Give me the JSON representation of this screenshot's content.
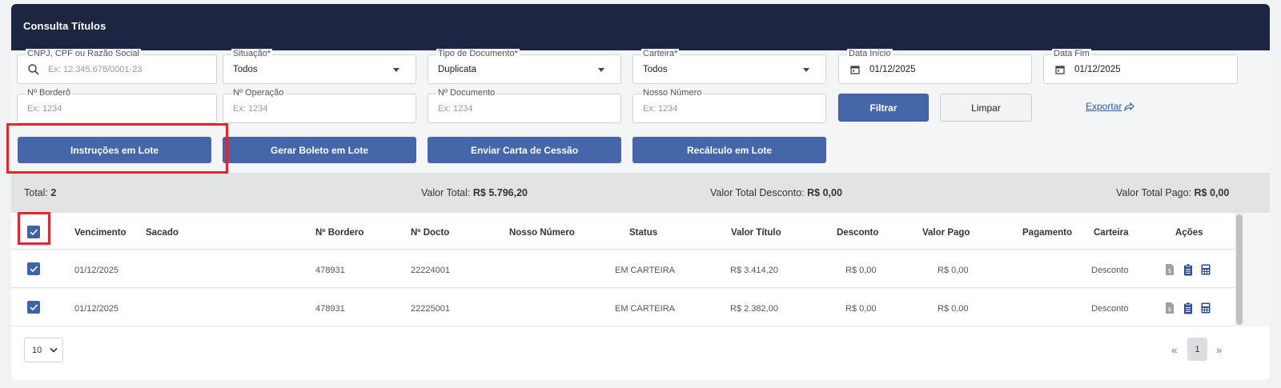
{
  "header": {
    "title": "Consulta Títulos"
  },
  "filters": {
    "cnpj": {
      "label": "CNPJ, CPF ou Razão Social",
      "placeholder": "Ex: 12.345.678/0001-23"
    },
    "situacao": {
      "label": "Situação*",
      "value": "Todos"
    },
    "tipo_documento": {
      "label": "Tipo de Documento*",
      "value": "Duplicata"
    },
    "carteira": {
      "label": "Carteira*",
      "value": "Todos"
    },
    "data_inicio": {
      "label": "Data Início",
      "value": "01/12/2025"
    },
    "data_fim": {
      "label": "Data Fim",
      "value": "01/12/2025"
    },
    "bordero": {
      "label": "Nº Borderô",
      "placeholder": "Ex: 1234"
    },
    "operacao": {
      "label": "Nº Operação",
      "placeholder": "Ex: 1234"
    },
    "documento": {
      "label": "Nº Documento",
      "placeholder": "Ex: 1234"
    },
    "nosso_numero": {
      "label": "Nosso Número",
      "placeholder": "Ex: 1234"
    },
    "filtrar_label": "Filtrar",
    "limpar_label": "Limpar",
    "exportar_label": "Exportar"
  },
  "batch_actions": {
    "instrucoes": "Instruções em Lote",
    "gerar_boleto": "Gerar Boleto em Lote",
    "enviar_carta": "Enviar Carta de Cessão",
    "recalculo": "Recálculo em Lote"
  },
  "summary": {
    "total_label": "Total:",
    "total_value": "2",
    "valor_total_label": "Valor Total:",
    "valor_total_value": "R$ 5.796,20",
    "desconto_label": "Valor Total Desconto:",
    "desconto_value": "R$ 0,00",
    "pago_label": "Valor Total Pago:",
    "pago_value": "R$ 0,00"
  },
  "table": {
    "columns": [
      "Vencimento",
      "Sacado",
      "Nº Bordero",
      "Nº Docto",
      "Nosso Número",
      "Status",
      "Valor Título",
      "Desconto",
      "Valor Pago",
      "Pagamento",
      "Carteira",
      "Ações"
    ],
    "rows": [
      {
        "vencimento": "01/12/2025",
        "sacado": "",
        "bordero": "478931",
        "docto": "22224001",
        "nosso_numero": "",
        "status": "EM CARTEIRA",
        "valor_titulo": "R$ 3.414,20",
        "desconto": "R$ 0,00",
        "valor_pago": "R$ 0,00",
        "pagamento": "",
        "carteira": "Desconto"
      },
      {
        "vencimento": "01/12/2025",
        "sacado": "",
        "bordero": "478931",
        "docto": "22225001",
        "nosso_numero": "",
        "status": "EM CARTEIRA",
        "valor_titulo": "R$ 2.382,00",
        "desconto": "R$ 0,00",
        "valor_pago": "R$ 0,00",
        "pagamento": "",
        "carteira": "Desconto"
      }
    ]
  },
  "pagination": {
    "page_size": "10",
    "prev": "«",
    "current": "1",
    "next": "»"
  },
  "icons": {
    "search": "search-icon",
    "calendar": "calendar-icon",
    "export": "share-icon",
    "check": "check-icon",
    "doc": "document-icon",
    "clipboard": "clipboard-icon",
    "calculator": "calculator-icon"
  },
  "colors": {
    "header_bg": "#1c2642",
    "primary": "#4566a9",
    "highlight": "#e3262b"
  }
}
